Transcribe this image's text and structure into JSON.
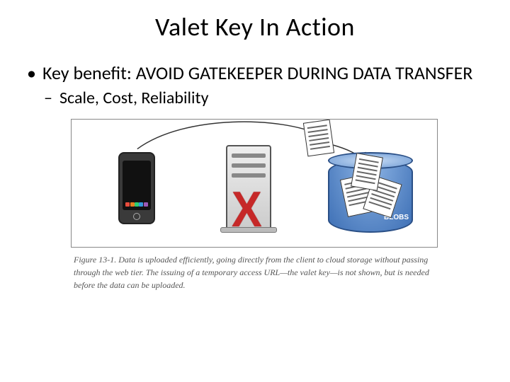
{
  "title": "Valet Key In Action",
  "bullets": {
    "b1": "Key benefit: AVOID GATEKEEPER DURING DATA TRANSFER",
    "b2": "Scale, Cost, Reliability"
  },
  "figure": {
    "blob_label": "BLOBS",
    "caption": "Figure 13-1. Data is uploaded efficiently, going directly from the client to cloud storage without passing through the web tier. The issuing of a temporary access URL—the valet key—is not shown, but is needed before the data can be uploaded.",
    "x_mark": "X"
  },
  "icons": {
    "phone": "phone-icon",
    "server": "server-icon",
    "bucket": "storage-bucket-icon",
    "document": "document-icon",
    "arrow": "upload-arrow-icon",
    "x": "cross-out-icon"
  }
}
